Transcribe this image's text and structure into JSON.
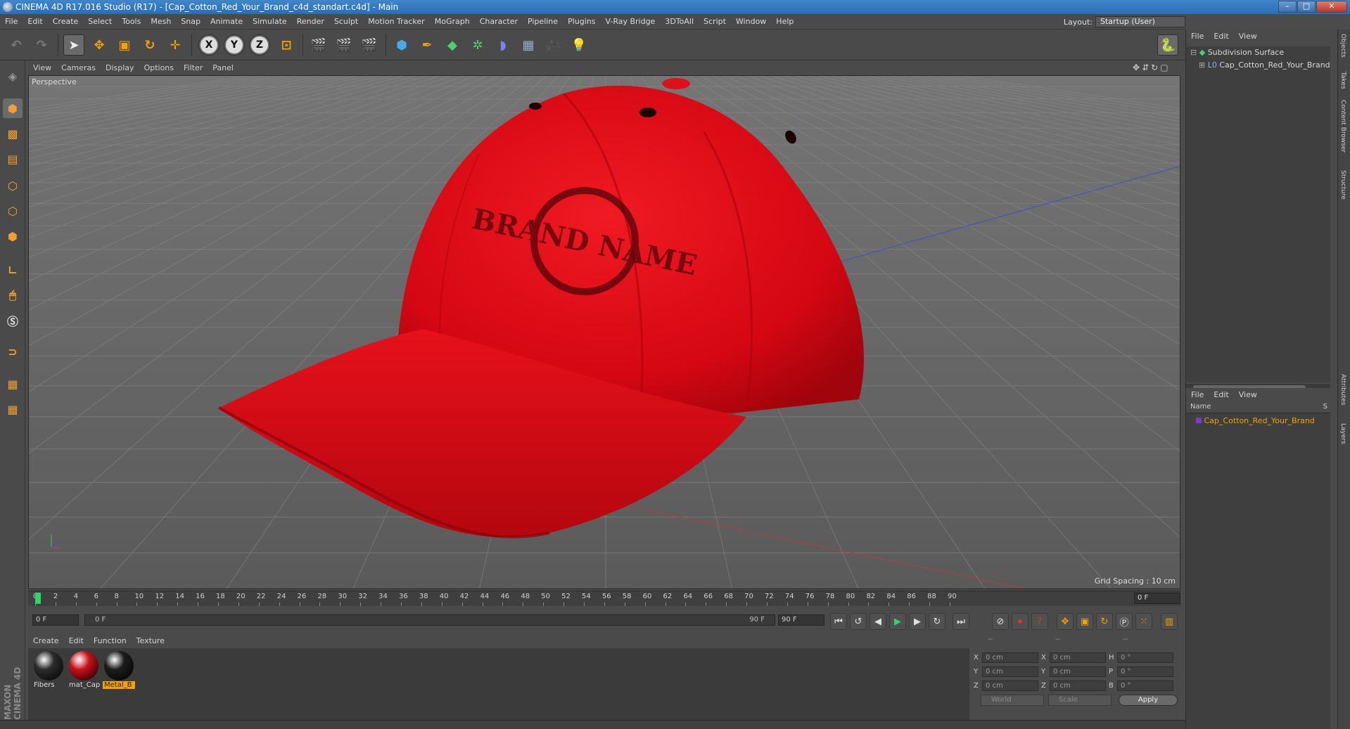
{
  "window": {
    "title": "CINEMA 4D R17.016 Studio (R17) - [Cap_Cotton_Red_Your_Brand_c4d_standart.c4d] - Main"
  },
  "menu": [
    "File",
    "Edit",
    "Create",
    "Select",
    "Tools",
    "Mesh",
    "Snap",
    "Animate",
    "Simulate",
    "Render",
    "Sculpt",
    "Motion Tracker",
    "MoGraph",
    "Character",
    "Pipeline",
    "Plugins",
    "V-Ray Bridge",
    "3DToAll",
    "Script",
    "Window",
    "Help"
  ],
  "layout": {
    "label": "Layout:",
    "value": "Startup (User)"
  },
  "toolbar": {
    "x_label": "X",
    "y_label": "Y",
    "z_label": "Z"
  },
  "viewport": {
    "menu": [
      "View",
      "Cameras",
      "Display",
      "Options",
      "Filter",
      "Panel"
    ],
    "label": "Perspective",
    "grid_spacing": "Grid Spacing : 10 cm",
    "cap_logo_text": "BRAND NAME"
  },
  "timeline": {
    "ticks": [
      "0",
      "2",
      "4",
      "6",
      "8",
      "10",
      "12",
      "14",
      "16",
      "18",
      "20",
      "22",
      "24",
      "26",
      "28",
      "30",
      "32",
      "34",
      "36",
      "38",
      "40",
      "42",
      "44",
      "46",
      "48",
      "50",
      "52",
      "54",
      "56",
      "58",
      "60",
      "62",
      "64",
      "66",
      "68",
      "70",
      "72",
      "74",
      "76",
      "78",
      "80",
      "82",
      "84",
      "86",
      "88",
      "90"
    ],
    "current_frame": "0 F",
    "start_field": "0 F",
    "slider_start": "0 F",
    "slider_end": "90 F",
    "end_field": "90 F"
  },
  "materials": {
    "menu": [
      "Create",
      "Edit",
      "Function",
      "Texture"
    ],
    "items": [
      {
        "name": "Fibers",
        "color": "#2b2b2b",
        "active": false
      },
      {
        "name": "mat_Cap",
        "color": "#c8101a",
        "active": false
      },
      {
        "name": "Metal_B",
        "color": "#1c1c1c",
        "active": true
      }
    ]
  },
  "coordinates": {
    "header": [
      "--",
      "--",
      "--"
    ],
    "rows": [
      {
        "a_label": "X",
        "a_value": "0 cm",
        "b_label": "X",
        "b_value": "0 cm",
        "c_label": "H",
        "c_value": "0 °"
      },
      {
        "a_label": "Y",
        "a_value": "0 cm",
        "b_label": "Y",
        "b_value": "0 cm",
        "c_label": "P",
        "c_value": "0 °"
      },
      {
        "a_label": "Z",
        "a_value": "0 cm",
        "b_label": "Z",
        "b_value": "0 cm",
        "c_label": "B",
        "c_value": "0 °"
      }
    ],
    "mode1": "World",
    "mode2": "Scale",
    "apply": "Apply"
  },
  "objects": {
    "menu": [
      "File",
      "Edit",
      "View"
    ],
    "items": [
      {
        "name": "Subdivision Surface"
      },
      {
        "name": "Cap_Cotton_Red_Your_Brand"
      }
    ]
  },
  "layers": {
    "menu": [
      "File",
      "Edit",
      "View"
    ],
    "col_name": "Name",
    "col_s": "S",
    "items": [
      {
        "name": "Cap_Cotton_Red_Your_Brand"
      }
    ]
  },
  "side_tabs": [
    "Objects",
    "Takes",
    "Content Browser",
    "Structure",
    "Attributes",
    "Layers"
  ],
  "brand": {
    "logo": "MAXON CINEMA 4D"
  },
  "colors": {
    "accent": "#f3a200",
    "cap_red": "#e00818",
    "grid_bg": "#5c5c5c"
  }
}
